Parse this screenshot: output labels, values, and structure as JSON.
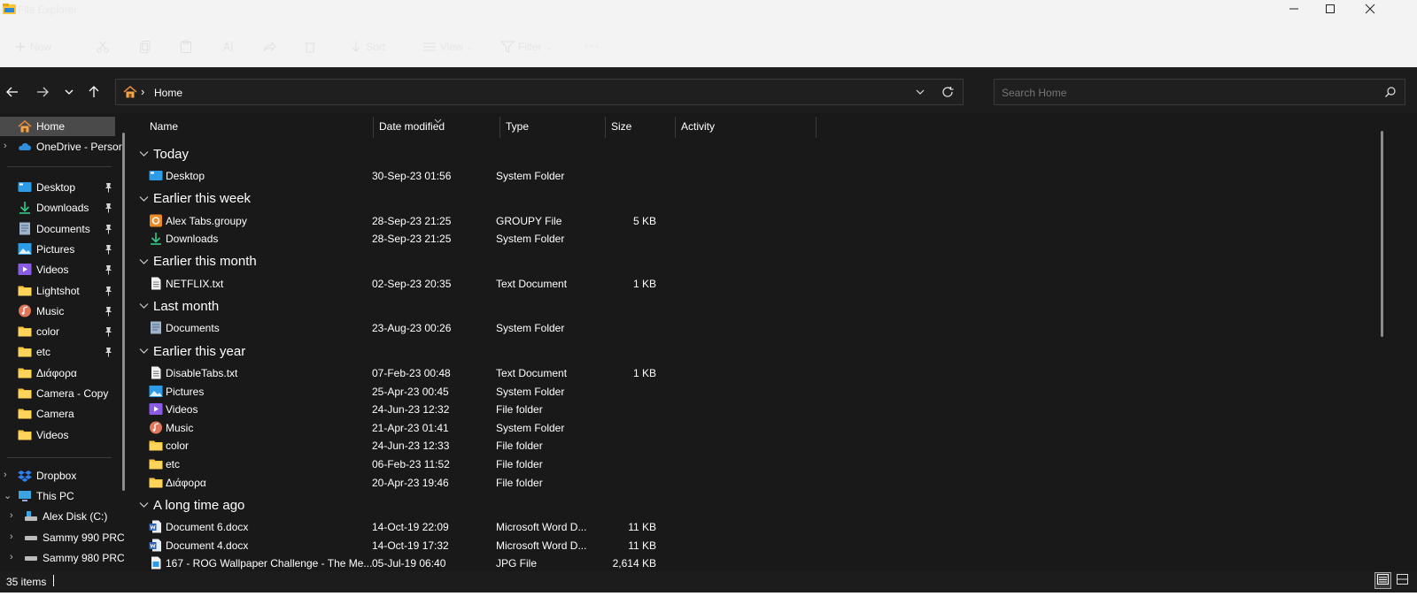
{
  "window": {
    "title": "File Explorer",
    "minimize_icon": "minimize-icon",
    "maximize_icon": "maximize-icon",
    "close_icon": "close-icon"
  },
  "command_bar": {
    "new_label": "New",
    "sort_label": "Sort",
    "view_label": "View",
    "filter_label": "Filter",
    "more_label": "···"
  },
  "nav": {
    "back_icon": "arrow-left-icon",
    "forward_icon": "arrow-right-icon",
    "recent_icon": "chevron-down-icon",
    "up_icon": "arrow-up-icon"
  },
  "address": {
    "separator": "›",
    "location": "Home"
  },
  "search": {
    "placeholder": "Search Home"
  },
  "sidebar": {
    "home": "Home",
    "onedrive": "OneDrive - Persor",
    "quick_access": [
      {
        "label": "Desktop",
        "icon": "desktop-icon",
        "pinned": true
      },
      {
        "label": "Downloads",
        "icon": "download-icon",
        "pinned": true
      },
      {
        "label": "Documents",
        "icon": "documents-icon",
        "pinned": true
      },
      {
        "label": "Pictures",
        "icon": "pictures-icon",
        "pinned": true
      },
      {
        "label": "Videos",
        "icon": "videos-icon",
        "pinned": true
      },
      {
        "label": "Lightshot",
        "icon": "folder-icon",
        "pinned": true
      },
      {
        "label": "Music",
        "icon": "music-icon",
        "pinned": true
      },
      {
        "label": "color",
        "icon": "folder-icon",
        "pinned": true
      },
      {
        "label": "etc",
        "icon": "folder-icon",
        "pinned": true
      },
      {
        "label": "Διάφορα",
        "icon": "folder-icon",
        "pinned": false
      },
      {
        "label": "Camera - Copy",
        "icon": "folder-icon",
        "pinned": false
      },
      {
        "label": "Camera",
        "icon": "folder-icon",
        "pinned": false
      },
      {
        "label": "Videos",
        "icon": "folder-icon",
        "pinned": false
      }
    ],
    "dropbox": "Dropbox",
    "this_pc": "This PC",
    "drives": [
      "Alex Disk (C:)",
      "Sammy 990 PRC",
      "Sammy 980 PRC"
    ]
  },
  "columns": {
    "name": "Name",
    "date": "Date modified",
    "type": "Type",
    "size": "Size",
    "activity": "Activity"
  },
  "groups": [
    {
      "title": "Today",
      "rows": [
        {
          "name": "Desktop",
          "date": "30-Sep-23 01:56",
          "type": "System Folder",
          "size": "",
          "icon": "desktop-icon"
        }
      ]
    },
    {
      "title": "Earlier this week",
      "rows": [
        {
          "name": "Alex Tabs.groupy",
          "date": "28-Sep-23 21:25",
          "type": "GROUPY File",
          "size": "5 KB",
          "icon": "groupy-file-icon"
        },
        {
          "name": "Downloads",
          "date": "28-Sep-23 21:25",
          "type": "System Folder",
          "size": "",
          "icon": "download-icon"
        }
      ]
    },
    {
      "title": "Earlier this month",
      "rows": [
        {
          "name": "NETFLIX.txt",
          "date": "02-Sep-23 20:35",
          "type": "Text Document",
          "size": "1 KB",
          "icon": "text-file-icon"
        }
      ]
    },
    {
      "title": "Last month",
      "rows": [
        {
          "name": "Documents",
          "date": "23-Aug-23 00:26",
          "type": "System Folder",
          "size": "",
          "icon": "documents-icon"
        }
      ]
    },
    {
      "title": "Earlier this year",
      "rows": [
        {
          "name": "DisableTabs.txt",
          "date": "07-Feb-23 00:48",
          "type": "Text Document",
          "size": "1 KB",
          "icon": "text-file-icon"
        },
        {
          "name": "Pictures",
          "date": "25-Apr-23 00:45",
          "type": "System Folder",
          "size": "",
          "icon": "pictures-icon"
        },
        {
          "name": "Videos",
          "date": "24-Jun-23 12:32",
          "type": "File folder",
          "size": "",
          "icon": "videos-icon"
        },
        {
          "name": "Music",
          "date": "21-Apr-23 01:41",
          "type": "System Folder",
          "size": "",
          "icon": "music-icon"
        },
        {
          "name": "color",
          "date": "24-Jun-23 12:33",
          "type": "File folder",
          "size": "",
          "icon": "folder-icon"
        },
        {
          "name": "etc",
          "date": "06-Feb-23 11:52",
          "type": "File folder",
          "size": "",
          "icon": "folder-icon"
        },
        {
          "name": "Διάφορα",
          "date": "20-Apr-23 19:46",
          "type": "File folder",
          "size": "",
          "icon": "folder-icon"
        }
      ]
    },
    {
      "title": "A long time ago",
      "rows": [
        {
          "name": "Document 6.docx",
          "date": "14-Oct-19 22:09",
          "type": "Microsoft Word D...",
          "size": "11 KB",
          "icon": "word-doc-icon"
        },
        {
          "name": "Document 4.docx",
          "date": "14-Oct-19 17:32",
          "type": "Microsoft Word D...",
          "size": "11 KB",
          "icon": "word-doc-icon"
        },
        {
          "name": "167 - ROG Wallpaper Challenge - The Me...",
          "date": "05-Jul-19 06:40",
          "type": "JPG File",
          "size": "2,614 KB",
          "icon": "image-file-icon"
        }
      ]
    }
  ],
  "status": {
    "item_count": "35 items"
  },
  "colors": {
    "background": "#191919",
    "chrome_light": "#f3f3f3",
    "folder_yellow": "#f8c43a",
    "accent_blue": "#4cc2ff",
    "selected": "#4a4a4a"
  }
}
